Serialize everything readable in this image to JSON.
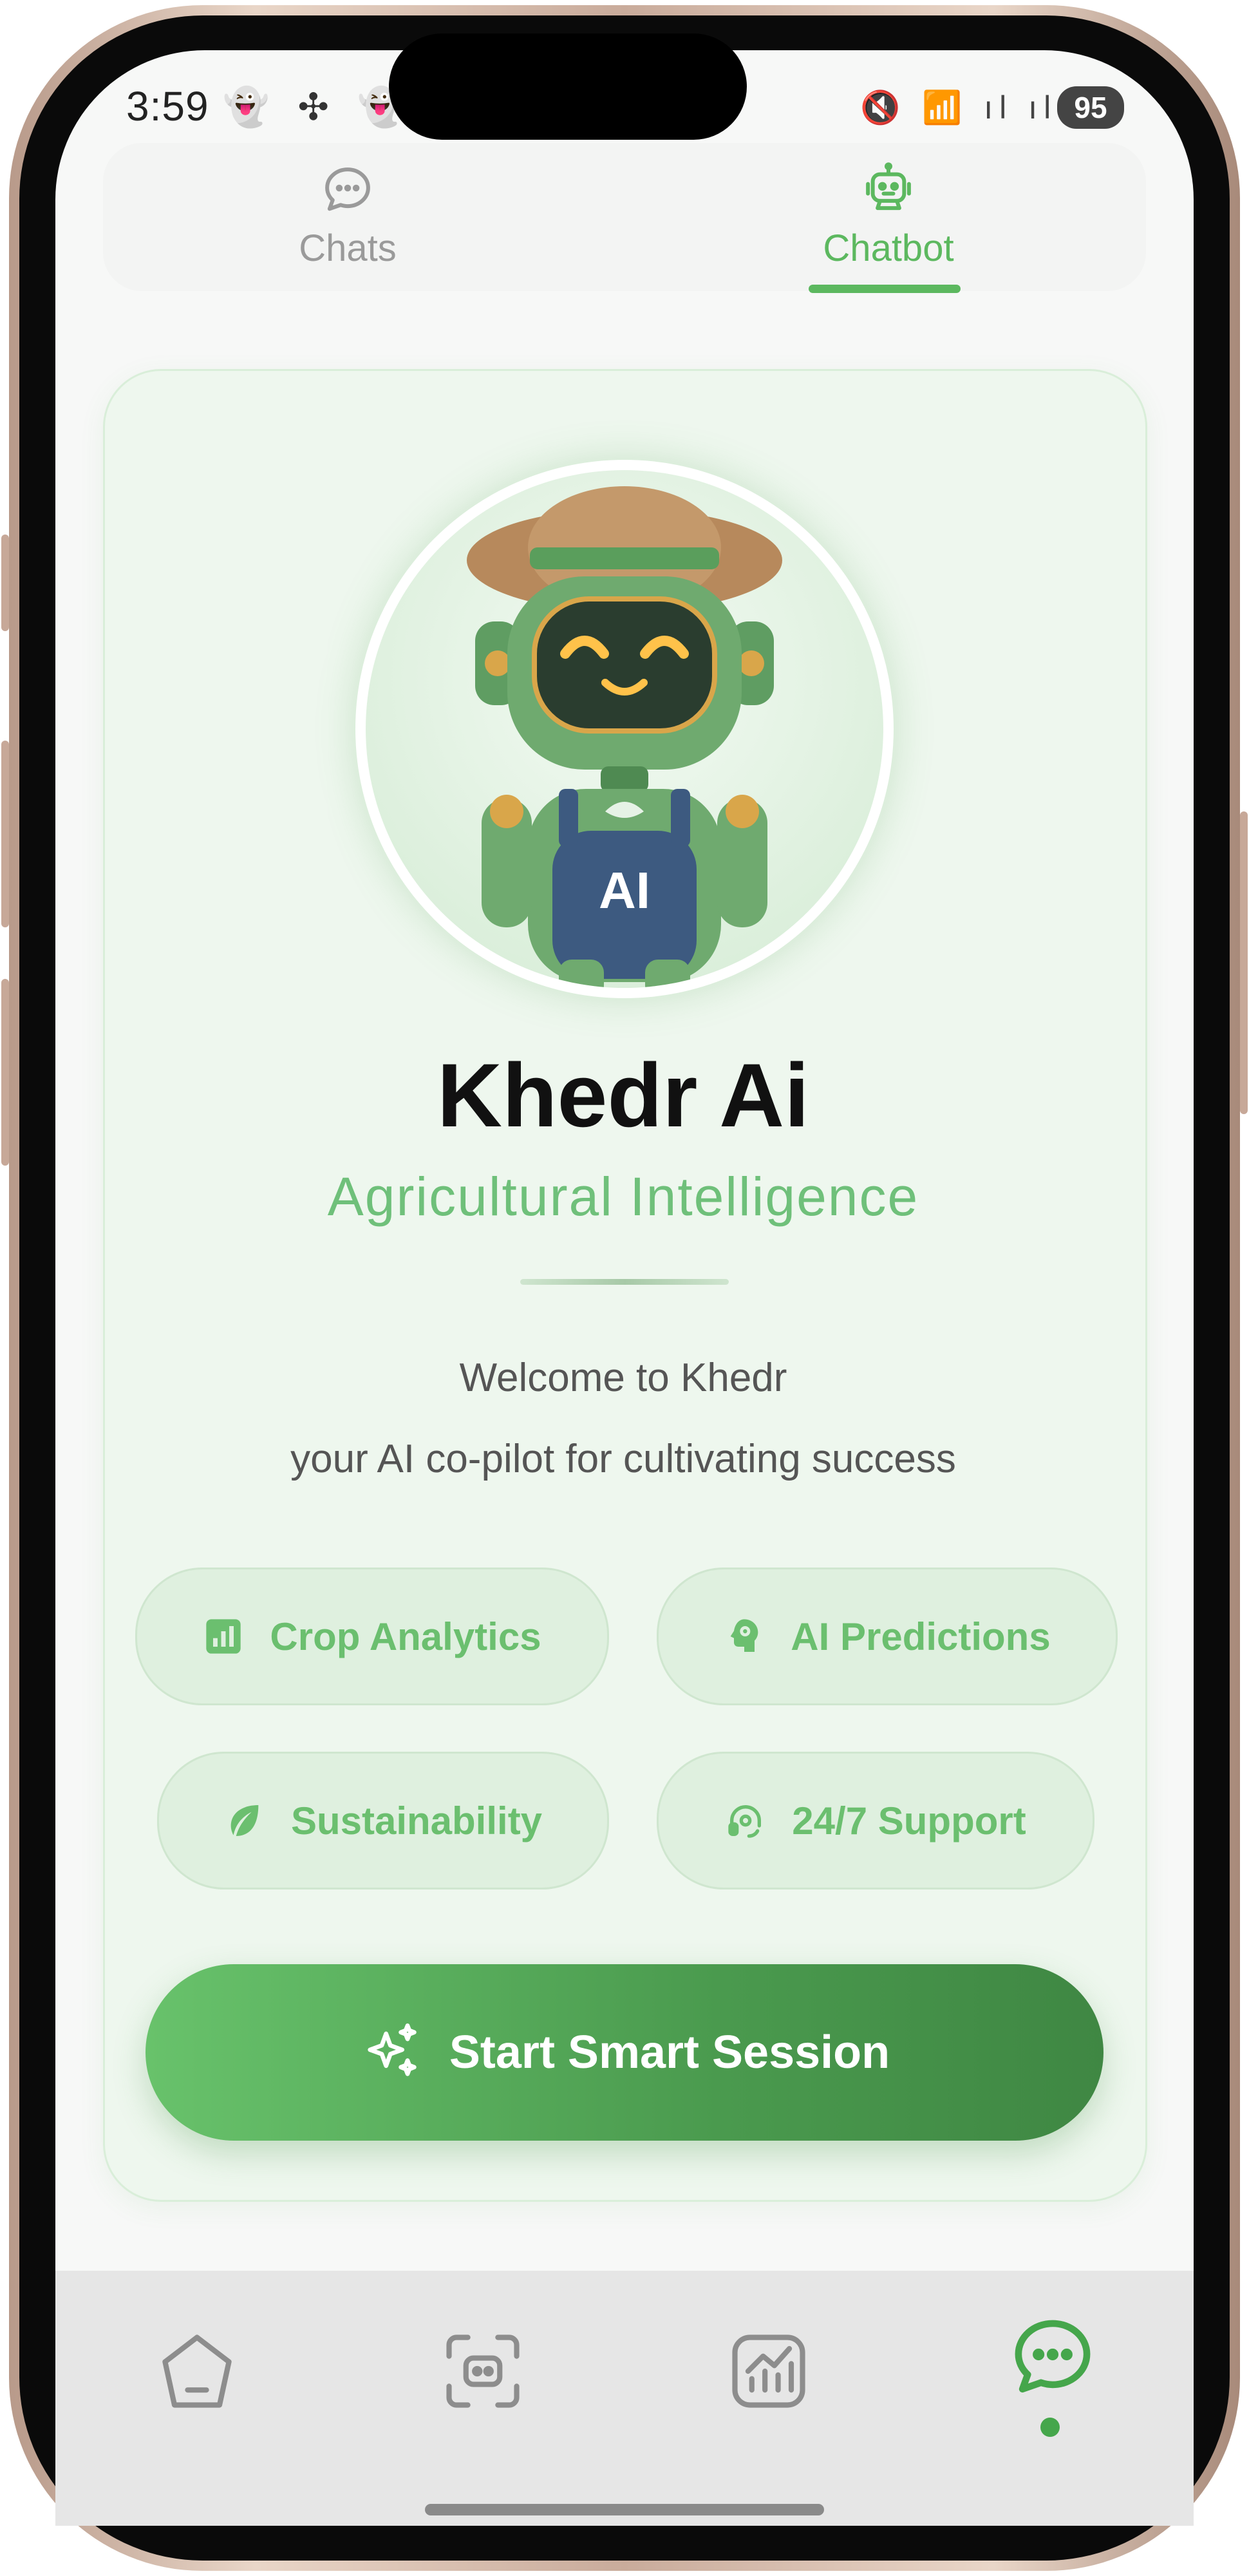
{
  "status_bar": {
    "time": "3:59",
    "left_icons": "👻 ✣ 👻 •",
    "right_icons": "🔇 📶 ıl ıl",
    "battery": "95"
  },
  "tabs": [
    {
      "label": "Chats",
      "icon": "chat-bubble-icon",
      "active": false
    },
    {
      "label": "Chatbot",
      "icon": "robot-icon",
      "active": true
    }
  ],
  "bot": {
    "name": "Khedr Ai",
    "tagline": "Agricultural Intelligence",
    "avatar_badge": "AI",
    "welcome_line1": "Welcome to Khedr",
    "welcome_line2": "your AI co-pilot for cultivating success"
  },
  "features": [
    {
      "label": "Crop Analytics",
      "icon": "bar-chart-icon"
    },
    {
      "label": "AI Predictions",
      "icon": "brain-head-icon"
    },
    {
      "label": "Sustainability",
      "icon": "leaf-icon"
    },
    {
      "label": "24/7 Support",
      "icon": "headset-icon"
    }
  ],
  "cta": {
    "label": "Start Smart Session",
    "icon": "sparkles-icon"
  },
  "bottom_nav": [
    {
      "icon": "home-icon",
      "active": false
    },
    {
      "icon": "scan-icon",
      "active": false
    },
    {
      "icon": "analytics-icon",
      "active": false
    },
    {
      "icon": "chat-icon",
      "active": true
    }
  ],
  "colors": {
    "accent": "#5cb85f",
    "cta_start": "#68c26b",
    "cta_end": "#3f8743",
    "pill_bg": "#dff0df",
    "card_bg": "#eef7ee"
  }
}
